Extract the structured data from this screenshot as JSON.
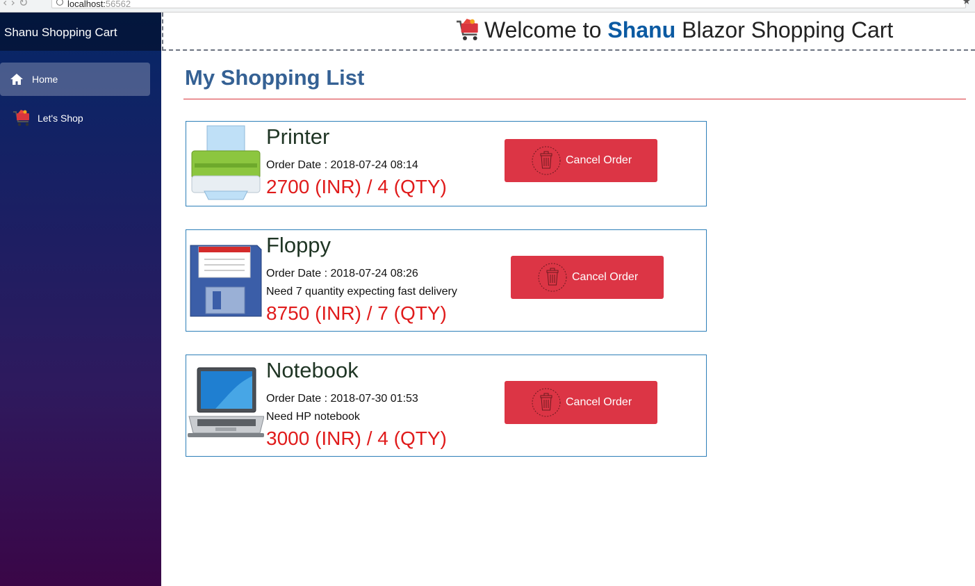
{
  "browser": {
    "url_host": "localhost:",
    "url_port": "56562"
  },
  "sidebar": {
    "brand": "Shanu Shopping Cart",
    "items": [
      {
        "label": "Home",
        "icon": "home-icon",
        "active": true
      },
      {
        "label": "Let's Shop",
        "icon": "cart-icon",
        "active": false
      }
    ]
  },
  "header": {
    "welcome_prefix": "Welcome to",
    "welcome_brand": "Shanu",
    "welcome_suffix": "Blazor Shopping Cart"
  },
  "main": {
    "title": "My Shopping List",
    "orders": [
      {
        "name": "Printer",
        "date_label": "Order Date : 2018-07-24 08:14",
        "note": "",
        "price": "2700 (INR) / 4 (QTY)",
        "button": "Cancel Order",
        "image": "printer-image"
      },
      {
        "name": "Floppy",
        "date_label": "Order Date : 2018-07-24 08:26",
        "note": "Need 7 quantity expecting fast delivery",
        "price": "8750 (INR) / 7 (QTY)",
        "button": "Cancel Order",
        "image": "floppy-image"
      },
      {
        "name": "Notebook",
        "date_label": "Order Date : 2018-07-30 01:53",
        "note": "Need HP notebook",
        "price": "3000 (INR) / 4 (QTY)",
        "button": "Cancel Order",
        "image": "notebook-image"
      }
    ]
  },
  "colors": {
    "accent_red": "#dc3545",
    "price_red": "#e01b1b",
    "title_blue": "#356194",
    "border_blue": "#2d7fb8"
  }
}
